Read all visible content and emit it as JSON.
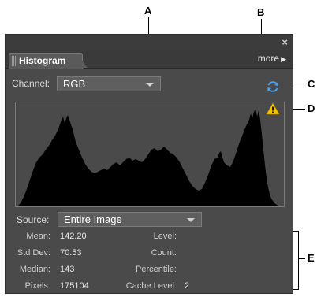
{
  "callouts": {
    "a": "A",
    "b": "B",
    "c": "C",
    "d": "D",
    "e": "E"
  },
  "panel": {
    "close_glyph": "×",
    "tab_label": "Histogram",
    "more_label": "more",
    "more_arrow": "▶"
  },
  "channel": {
    "label": "Channel:",
    "value": "RGB"
  },
  "source": {
    "label": "Source:",
    "value": "Entire Image"
  },
  "stats": {
    "mean_label": "Mean:",
    "mean_value": "142.20",
    "stddev_label": "Std Dev:",
    "stddev_value": "70.53",
    "median_label": "Median:",
    "median_value": "143",
    "pixels_label": "Pixels:",
    "pixels_value": "175104",
    "level_label": "Level:",
    "level_value": "",
    "count_label": "Count:",
    "count_value": "",
    "percentile_label": "Percentile:",
    "percentile_value": "",
    "cache_level_label": "Cache Level:",
    "cache_level_value": "2"
  },
  "colors": {
    "panel_bg": "#4a4a4a",
    "histogram_fill": "#000000",
    "refresh_icon": "#4aa3f0",
    "warning_icon": "#f5c400"
  },
  "icons": [
    "close-icon",
    "grip-icon",
    "chevron-right-icon",
    "dropdown-arrow-icon",
    "refresh-icon",
    "warning-icon"
  ]
}
